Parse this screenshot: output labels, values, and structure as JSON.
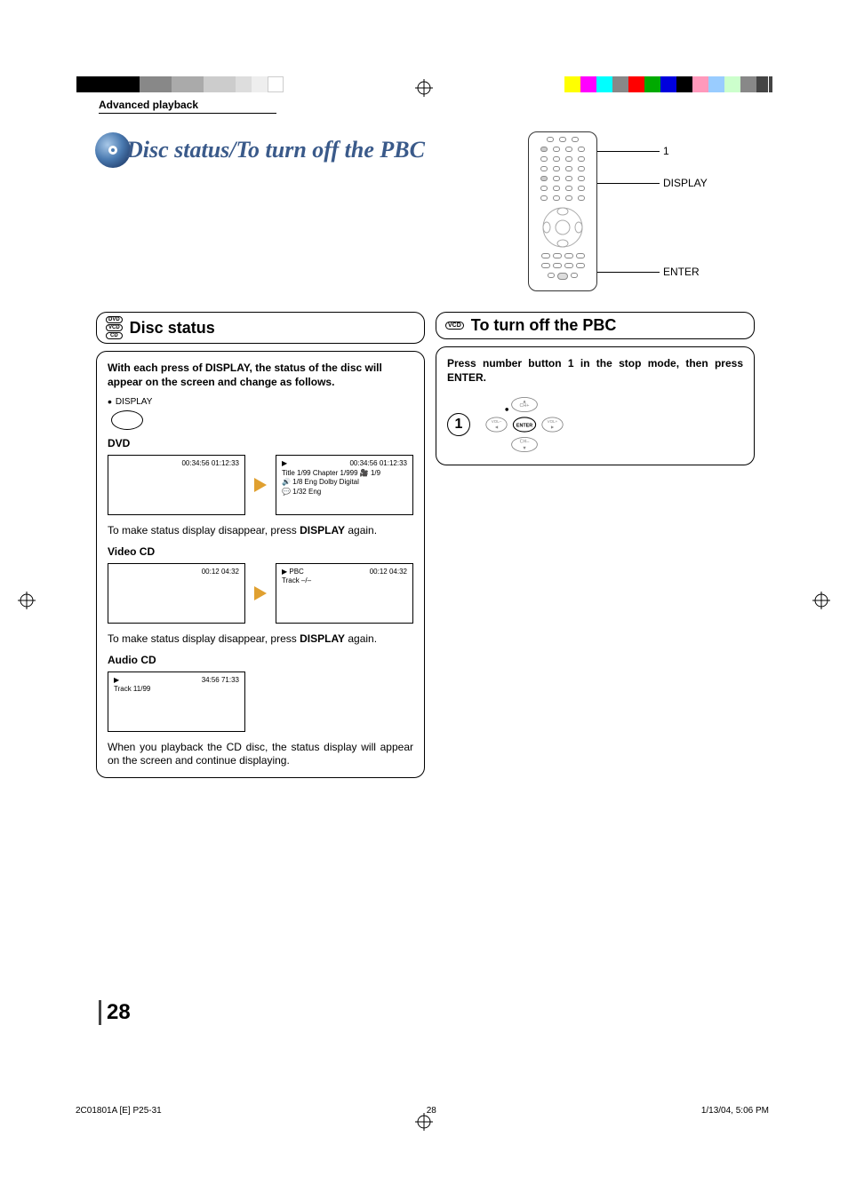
{
  "section_header": "Advanced playback",
  "page_title": "Disc status/To turn off the PBC",
  "remote_callouts": {
    "one": "1",
    "display": "DISPLAY",
    "enter": "ENTER"
  },
  "left_header": {
    "badges": [
      "DVD",
      "VCD",
      "CD"
    ],
    "title": "Disc status"
  },
  "right_header": {
    "badge": "VCD",
    "title": "To turn off the PBC"
  },
  "left_box": {
    "intro": "With each press of DISPLAY, the status of the disc will appear on the screen and change as follows.",
    "display_label": "DISPLAY",
    "dvd_label": "DVD",
    "dvd_osd1_line1": "00:34:56  01:12:33",
    "dvd_osd2_line0": "▶",
    "dvd_osd2_line1": "00:34:56 01:12:33",
    "dvd_osd2_line2": "Title      1/99   Chapter  1/999   🎥 1/9",
    "dvd_osd2_line3": "🔊 1/8   Eng Dolby Digital",
    "dvd_osd2_line4": "💬 1/32  Eng",
    "dvd_note_pre": "To make status display disappear, press ",
    "dvd_note_bold": "DISPLAY",
    "dvd_note_post": " again.",
    "vcd_label": "Video CD",
    "vcd_osd1_line1": "00:12      04:32",
    "vcd_osd2_line1": "▶ PBC",
    "vcd_osd2_time": "00:12      04:32",
    "vcd_osd2_line2": "Track    –/–",
    "vcd_note_pre": "To make status display disappear, press ",
    "vcd_note_bold": "DISPLAY",
    "vcd_note_post": " again.",
    "acd_label": "Audio CD",
    "acd_osd_play": "▶",
    "acd_osd_time": "34:56      71:33",
    "acd_osd_track": "Track 11/99",
    "acd_note": "When you playback the CD disc, the status display will appear on the screen and continue displaying."
  },
  "right_box": {
    "instruction": "Press number button 1 in the stop mode, then press ENTER.",
    "step": "1",
    "dpad": {
      "up": "CH+",
      "down": "CH–",
      "left": "VOL–",
      "right": "VOL+",
      "center": "ENTER"
    }
  },
  "page_number": "28",
  "footer": {
    "left": "2C01801A [E] P25-31",
    "center": "28",
    "right": "1/13/04, 5:06 PM"
  }
}
